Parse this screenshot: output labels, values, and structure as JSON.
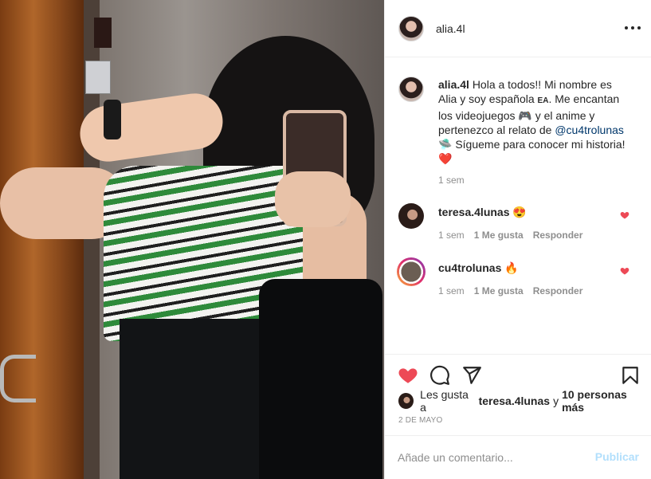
{
  "post": {
    "username": "alia.4l",
    "more_icon": "more-options-icon"
  },
  "caption": {
    "username": "alia.4l",
    "text_1": "Hola a todos!! Mi nombre es Alia y soy española ",
    "flag": "EA",
    "text_2": ". Me encantan los videojuegos ",
    "emoji_gamepad": "🎮",
    "text_3": " y el anime y pertenezco al relato de ",
    "mention": "@cu4trolunas",
    "emoji_ufo": "🛸",
    "text_4": " Sígueme para conocer mi historia!",
    "emoji_heart": "❤️",
    "time": "1 sem"
  },
  "comments": [
    {
      "username": "teresa.4lunas",
      "text": "😍",
      "time": "1 sem",
      "likes": "1 Me gusta",
      "reply": "Responder"
    },
    {
      "username": "cu4trolunas",
      "text": "🔥",
      "time": "1 sem",
      "likes": "1 Me gusta",
      "reply": "Responder"
    }
  ],
  "likes": {
    "prefix": "Les gusta a",
    "user": "teresa.4lunas",
    "middle": "y",
    "others": "10 personas más"
  },
  "date": "2 DE MAYO",
  "add_comment": {
    "placeholder": "Añade un comentario...",
    "publish": "Publicar"
  },
  "colors": {
    "like_red": "#ed4956",
    "publish_disabled": "#b2dffc",
    "mention": "#00376b",
    "muted": "#8e8e8e"
  }
}
